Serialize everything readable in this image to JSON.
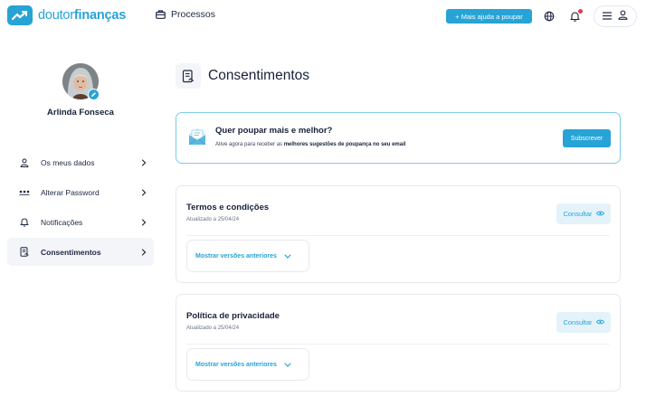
{
  "header": {
    "logo_part1": "doutor",
    "logo_part2": "finanças",
    "processos_label": "Processos",
    "mais_ajuda_label": "+ Mais ajuda a poupar",
    "accent": "#27a3d6",
    "notification_dot_color": "#e6394a"
  },
  "profile": {
    "name": "Arlinda Fonseca"
  },
  "sidebar": {
    "items": [
      {
        "label": "Os meus dados",
        "icon": "user-icon",
        "active": false
      },
      {
        "label": "Alterar Password",
        "icon": "password-dots-icon",
        "active": false
      },
      {
        "label": "Notificações",
        "icon": "bell-icon",
        "active": false
      },
      {
        "label": "Consentimentos",
        "icon": "consent-document-icon",
        "active": true
      }
    ]
  },
  "main": {
    "title": "Consentimentos",
    "promo": {
      "title": "Quer poupar mais e melhor?",
      "text_prefix": "Ative agora para receber as ",
      "text_bold": "melhores sugestões de poupança no seu email",
      "button_label": "Subscrever"
    },
    "cards": [
      {
        "title": "Termos e condições",
        "updated": "Atualizado a 25/04/24",
        "consult_label": "Consultar",
        "versions_label": "Mostrar versões anteriores"
      },
      {
        "title": "Política de privacidade",
        "updated": "Atualizado a 25/04/24",
        "consult_label": "Consultar",
        "versions_label": "Mostrar versões anteriores"
      }
    ]
  }
}
